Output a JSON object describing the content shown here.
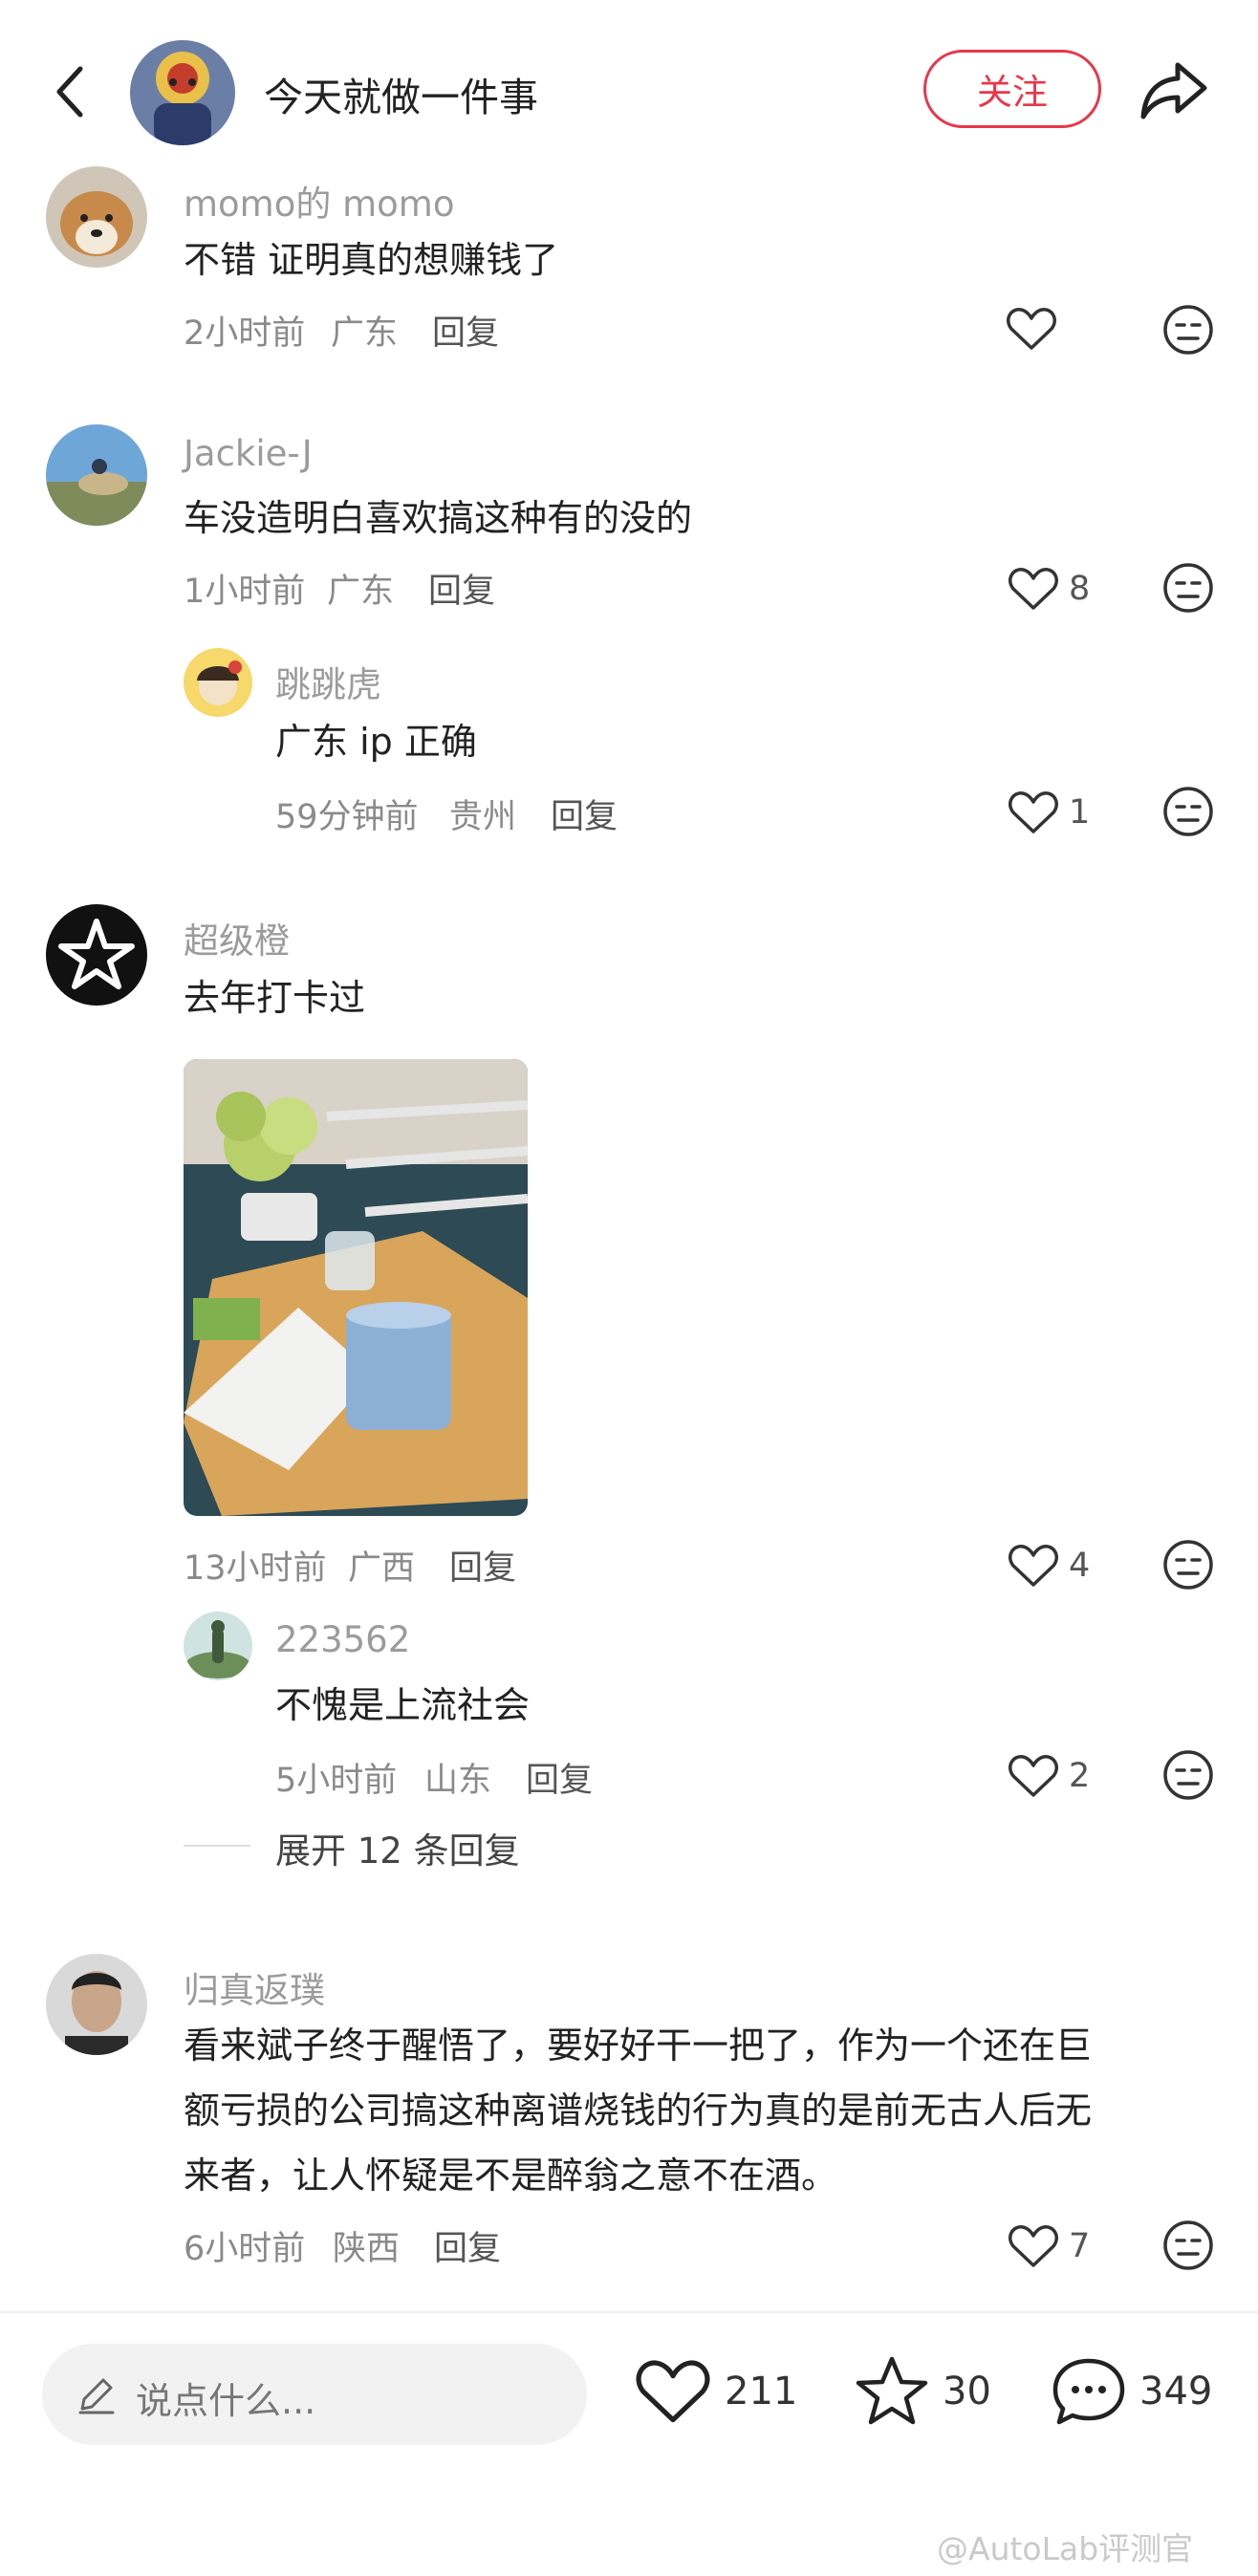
{
  "header": {
    "title": "今天就做一件事",
    "follow_label": "关注"
  },
  "comments": [
    {
      "user": "momo的 momo",
      "text": "不错 证明真的想赚钱了",
      "time": "2小时前",
      "location": "广东",
      "reply": "回复",
      "likes": ""
    },
    {
      "user": "Jackie-J",
      "text": "车没造明白喜欢搞这种有的没的",
      "time": "1小时前",
      "location": "广东",
      "reply": "回复",
      "likes": "8",
      "replies": [
        {
          "user": "跳跳虎",
          "text": "广东 ip 正确",
          "time": "59分钟前",
          "location": "贵州",
          "reply": "回复",
          "likes": "1"
        }
      ]
    },
    {
      "user": "超级橙",
      "text": "去年打卡过",
      "time": "13小时前",
      "location": "广西",
      "reply": "回复",
      "likes": "4",
      "replies": [
        {
          "user": "223562",
          "text": "不愧是上流社会",
          "time": "5小时前",
          "location": "山东",
          "reply": "回复",
          "likes": "2"
        }
      ],
      "expand_label": "展开 12 条回复"
    },
    {
      "user": "归真返璞",
      "text_lines": [
        "看来斌子终于醒悟了，要好好干一把了，作为一个还在巨",
        "额亏损的公司搞这种离谱烧钱的行为真的是前无古人后无",
        "来者，让人怀疑是不是醉翁之意不在酒。"
      ],
      "time": "6小时前",
      "location": "陕西",
      "reply": "回复",
      "likes": "7"
    }
  ],
  "bottom_bar": {
    "input_placeholder": "说点什么...",
    "likes": "211",
    "favorites": "30",
    "comments": "349"
  },
  "watermark": "@AutoLab评测官",
  "colors": {
    "accent": "#e8374a",
    "meta": "#8a8a8a",
    "username": "#9b9b9b"
  }
}
